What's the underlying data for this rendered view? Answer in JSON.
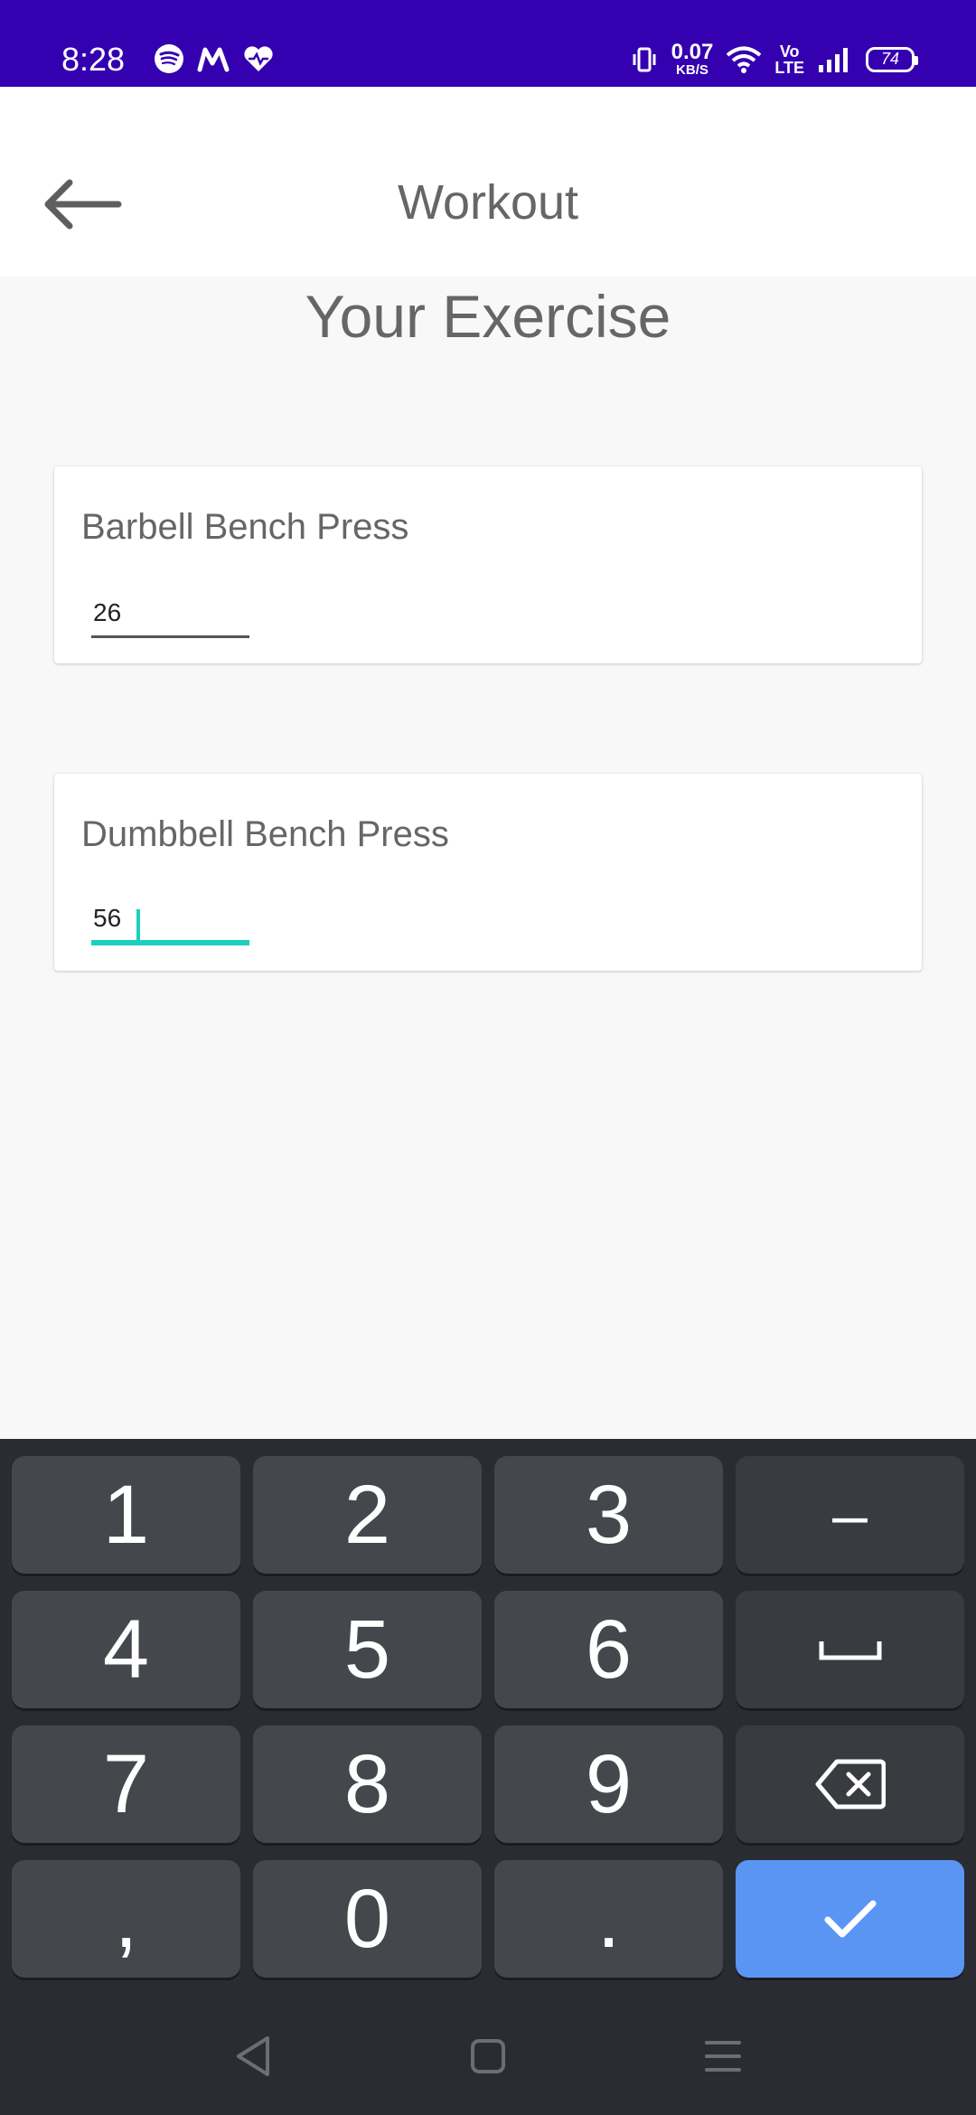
{
  "status_bar": {
    "time": "8:28",
    "net_speed_value": "0.07",
    "net_speed_unit": "KB/S",
    "volte_top": "Vo",
    "volte_bottom": "LTE",
    "battery": "74",
    "background_color": "#3400b0",
    "app_icons": [
      "spotify-icon",
      "m-app-icon",
      "heart-health-icon"
    ]
  },
  "app_bar": {
    "title": "Workout",
    "back_icon": "arrow-back-icon"
  },
  "page": {
    "heading": "Your Exercise"
  },
  "exercises": [
    {
      "name": "Barbell Bench Press",
      "value": "26",
      "focused": false
    },
    {
      "name": "Dumbbell Bench Press",
      "value": "56",
      "focused": true
    }
  ],
  "accent_color": "#1ccfbf",
  "keyboard": {
    "rows": [
      [
        "1",
        "2",
        "3",
        "–"
      ],
      [
        "4",
        "5",
        "6",
        "space-icon"
      ],
      [
        "7",
        "8",
        "9",
        "backspace-icon"
      ],
      [
        ",",
        "0",
        ".",
        "check-icon"
      ]
    ],
    "enter_color": "#5b95f3"
  },
  "nav_bar": [
    "back-triangle-icon",
    "home-square-icon",
    "recents-menu-icon"
  ]
}
